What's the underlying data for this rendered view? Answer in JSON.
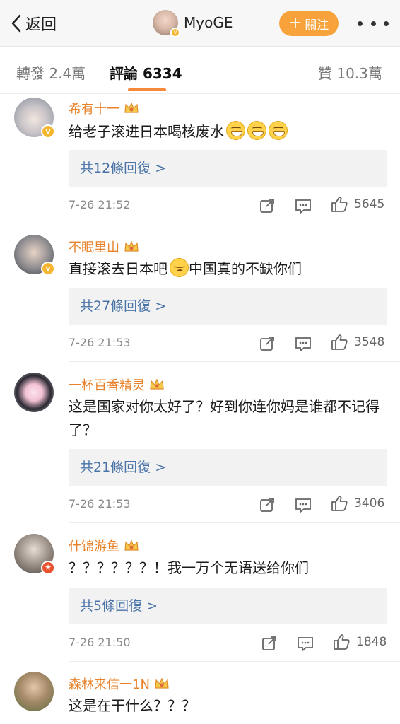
{
  "header": {
    "back_label": "返回",
    "username": "MyoGE",
    "follow_label": "關注"
  },
  "tabs": {
    "repost": "轉發 2.4萬",
    "comments": "評論 6334",
    "likes": "贊 10.3萬"
  },
  "comments": [
    {
      "name": "希有十一",
      "text": "给老子滚进日本喝核废水",
      "emojis": [
        "grin",
        "grin",
        "grin"
      ],
      "replies": "共12條回復 >",
      "time": "7-26 21:52",
      "likes": "5645"
    },
    {
      "name": "不眠里山",
      "text_a": "直接滚去日本吧",
      "text_b": "中国真的不缺你们",
      "replies": "共27條回復 >",
      "time": "7-26 21:53",
      "likes": "3548"
    },
    {
      "name": "一杯百香精灵",
      "text": "这是国家对你太好了？好到你连你妈是谁都不记得了？",
      "replies": "共21條回復 >",
      "time": "7-26 21:53",
      "likes": "3406"
    },
    {
      "name": "什锦游鱼",
      "text": "？？？？？？！我一万个无语送给你们",
      "replies": "共5條回復 >",
      "time": "7-26 21:50",
      "likes": "1848"
    },
    {
      "name": "森林来信一1N",
      "text": "这是在干什么？？？"
    }
  ],
  "colors": {
    "accent": "#f7a23a",
    "name": "#e8822a",
    "link": "#4a74a8"
  }
}
